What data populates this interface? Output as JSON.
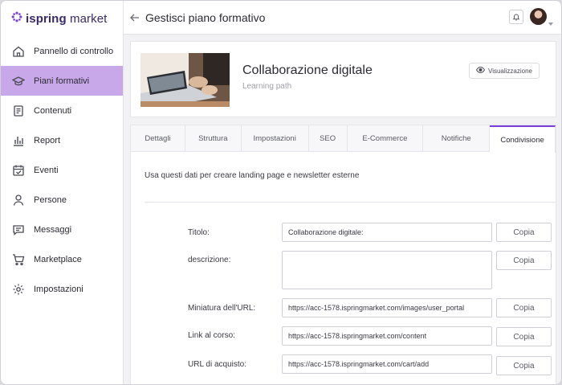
{
  "app": {
    "logo_text_left": "ispring",
    "logo_text_right": "market",
    "brand_color": "#7a3fd6"
  },
  "sidebar": {
    "items": [
      {
        "label": "Pannello di controllo",
        "icon": "home-icon"
      },
      {
        "label": "Piani formativi",
        "icon": "graduation-cap-icon",
        "active": true
      },
      {
        "label": "Contenuti",
        "icon": "document-icon"
      },
      {
        "label": "Report",
        "icon": "bar-chart-icon"
      },
      {
        "label": "Eventi",
        "icon": "calendar-check-icon"
      },
      {
        "label": "Persone",
        "icon": "person-icon"
      },
      {
        "label": "Messaggi",
        "icon": "message-icon"
      },
      {
        "label": "Marketplace",
        "icon": "cart-icon"
      },
      {
        "label": "Impostazioni",
        "icon": "gear-icon"
      }
    ]
  },
  "header": {
    "title": "Gestisci piano formativo"
  },
  "course": {
    "title": "Collaborazione digitale",
    "subtitle": "Learning path",
    "view_button": "Visualizzazione"
  },
  "tabs": [
    {
      "label": "Dettagli"
    },
    {
      "label": "Struttura"
    },
    {
      "label": "Impostazioni"
    },
    {
      "label": "SEO"
    },
    {
      "label": "E-Commerce"
    },
    {
      "label": "Notifiche"
    },
    {
      "label": "Condivisione",
      "active": true
    }
  ],
  "sharing": {
    "intro": "Usa questi dati per creare landing page e newsletter esterne",
    "copy_label": "Copia",
    "fields": [
      {
        "label": "Titolo:",
        "value": "Collaborazione digitale:"
      },
      {
        "label": "descrizione:",
        "value": ""
      },
      {
        "label": "Miniatura dell'URL:",
        "value": "https://acc-1578.ispringmarket.com/images/user_portal"
      },
      {
        "label": "Link al corso:",
        "value": "https://acc-1578.ispringmarket.com/content"
      },
      {
        "label": "URL di acquisto:",
        "value": "https://acc-1578.ispringmarket.com/cart/add"
      }
    ]
  }
}
